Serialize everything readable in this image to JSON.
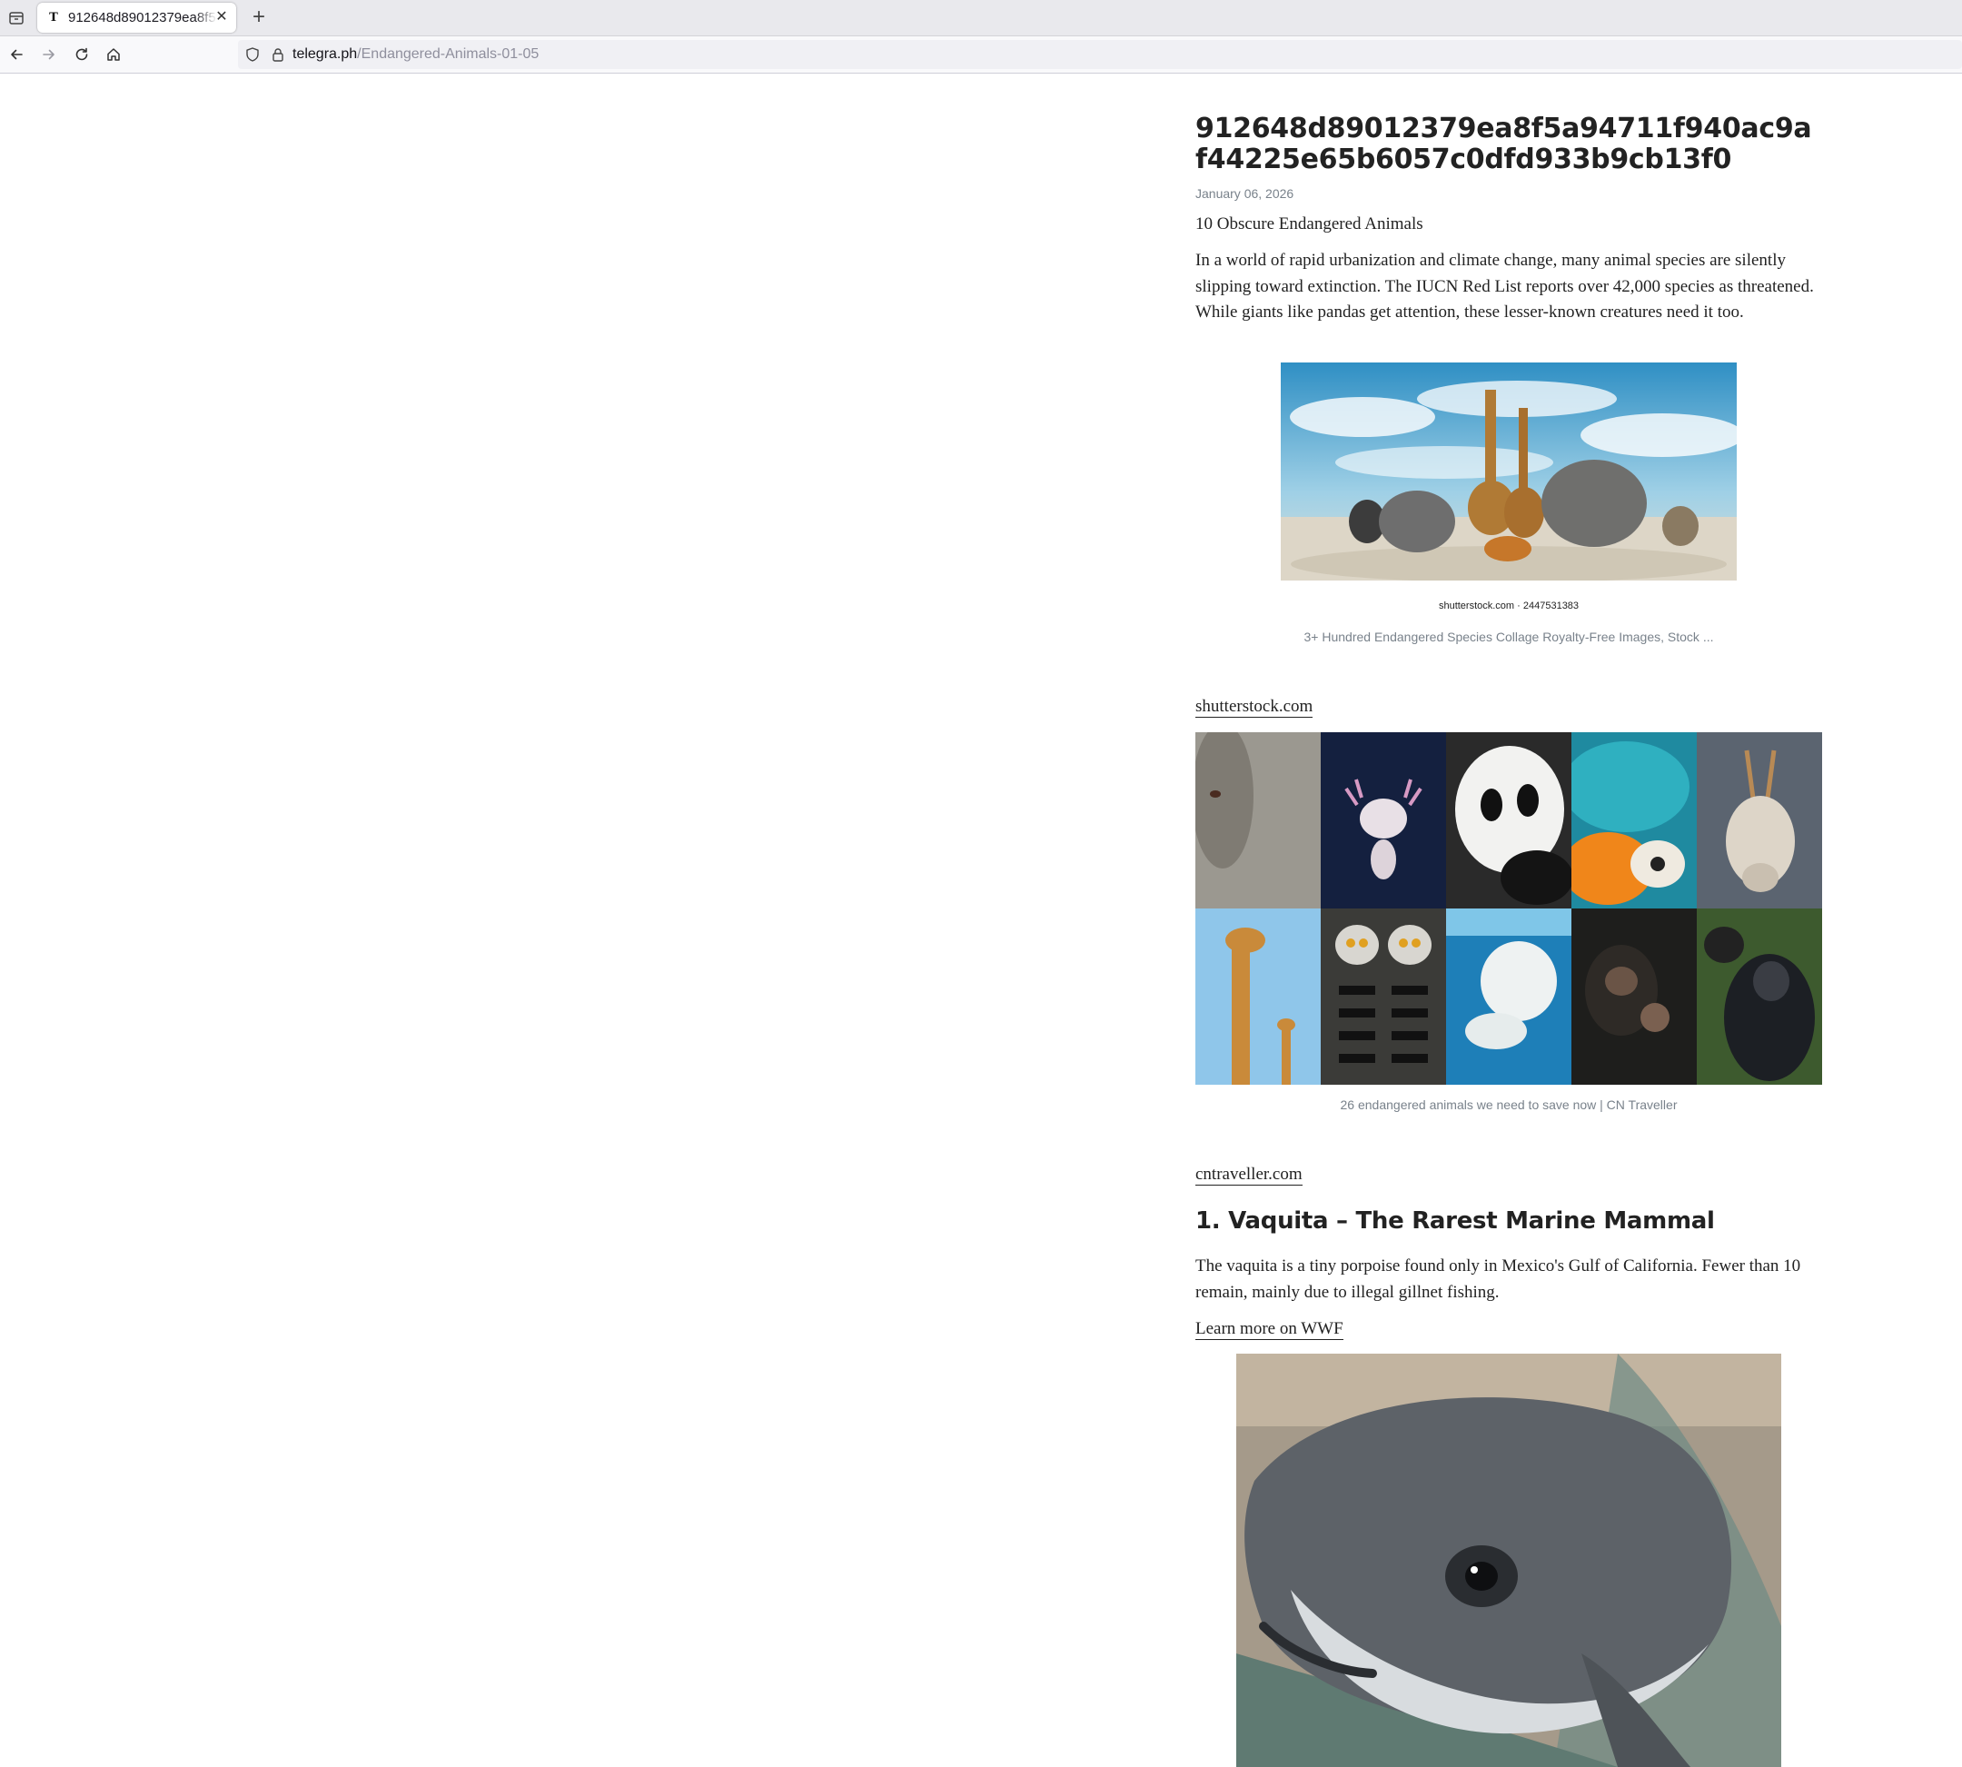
{
  "browser": {
    "tab_title": "912648d89012379ea8f5a94711f940ac9af44225e65b6057c0dfd933b9cb13f0",
    "tab_favicon": "T",
    "tab_close": "✕",
    "new_tab": "+",
    "url_host": "telegra.ph",
    "url_path": "/Endangered-Animals-01-05"
  },
  "article": {
    "title": "912648d89012379ea8f5a94711f940ac9af44225e65b6057c0dfd933b9cb13f0",
    "date": "January 06, 2026",
    "subtitle": "10 Obscure Endangered Animals",
    "intro": "In a world of rapid urbanization and climate change, many animal species are silently slipping toward extinction. The IUCN Red List reports over 42,000 species as threatened. While giants like pandas get attention, these lesser-known creatures need it too.",
    "figure1": {
      "credit": "shutterstock.com · 2447531383",
      "caption": "3+ Hundred Endangered Species Collage Royalty-Free Images, Stock ...",
      "source": "shutterstock.com"
    },
    "figure2": {
      "caption": "26 endangered animals we need to save now | CN Traveller",
      "source": "cntraveller.com"
    },
    "section1": {
      "heading": "1. Vaquita – The Rarest Marine Mammal",
      "body": "The vaquita is a tiny porpoise found only in Mexico's Gulf of California. Fewer than 10 remain, mainly due to illegal gillnet fishing.",
      "link": "Learn more on WWF"
    }
  },
  "icons": {
    "tab_list": "tab-list-icon",
    "back": "back-arrow-icon",
    "forward": "forward-arrow-icon",
    "reload": "reload-icon",
    "home": "home-icon",
    "shield": "shield-icon",
    "lock": "lock-icon"
  }
}
